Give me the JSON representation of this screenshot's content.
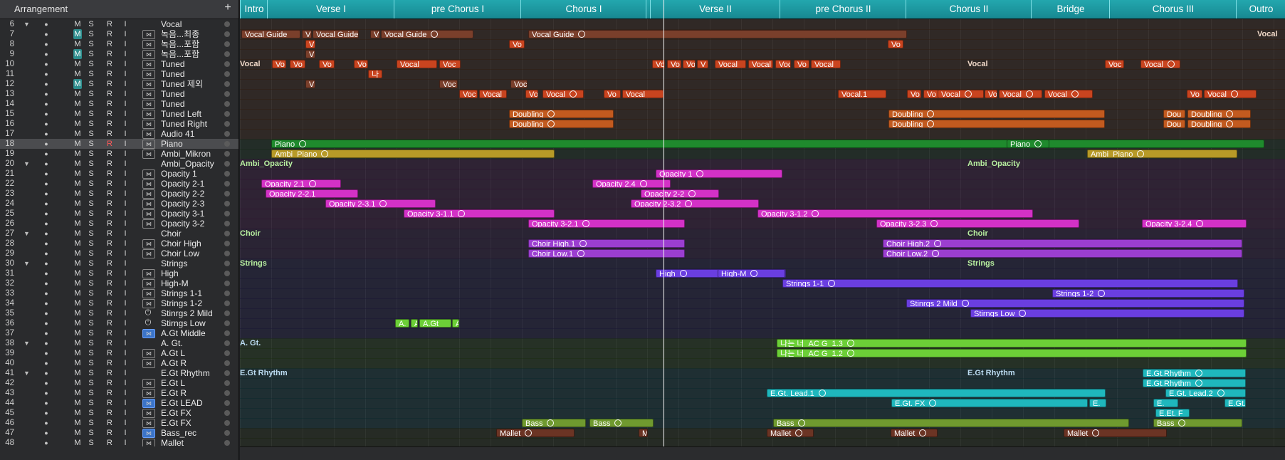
{
  "header": {
    "title": "Arrangement",
    "add_label": "+"
  },
  "colors": {
    "vocal": "#c9441f",
    "vocal_dark": "#7a3f2b",
    "piano": "#1f8a2d",
    "ambi": "#b79a27",
    "opacity": "#d331c6",
    "choir": "#9b3ed0",
    "strings": "#6a3ee0",
    "agt": "#6ccf37",
    "egt": "#1fb7bd",
    "bass": "#6f9a2f",
    "mallet": "#6b3424",
    "doubling": "#c25a1f"
  },
  "markers": [
    {
      "label": "Intro"
    },
    {
      "label": "Verse I"
    },
    {
      "label": "pre Chorus I"
    },
    {
      "label": "Chorus I"
    },
    {
      "label": "Verse II"
    },
    {
      "label": "pre Chorus II"
    },
    {
      "label": "Chorus II"
    },
    {
      "label": "Bridge"
    },
    {
      "label": "Chorus III"
    },
    {
      "label": "Outro"
    }
  ],
  "tracks": [
    {
      "num": "6",
      "name": "Vocal",
      "folder": true
    },
    {
      "num": "7",
      "name": "녹음...최종",
      "m_on": true
    },
    {
      "num": "8",
      "name": "녹음...포함"
    },
    {
      "num": "9",
      "name": "녹음...포함",
      "m_on": true
    },
    {
      "num": "10",
      "name": "Tuned"
    },
    {
      "num": "11",
      "name": "Tuned"
    },
    {
      "num": "12",
      "name": "Tuned 제외",
      "m_on": true
    },
    {
      "num": "13",
      "name": "Tuned"
    },
    {
      "num": "14",
      "name": "Tuned"
    },
    {
      "num": "15",
      "name": "Tuned Left"
    },
    {
      "num": "16",
      "name": "Tuned Right"
    },
    {
      "num": "17",
      "name": "Audio 41"
    },
    {
      "num": "18",
      "name": "Piano",
      "rec": true,
      "selected": true
    },
    {
      "num": "19",
      "name": "Ambi_Mikron"
    },
    {
      "num": "20",
      "name": "Ambi_Opacity",
      "folder": true
    },
    {
      "num": "21",
      "name": "Opacity 1"
    },
    {
      "num": "22",
      "name": "Opacity 2-1"
    },
    {
      "num": "23",
      "name": "Opacity 2-2"
    },
    {
      "num": "24",
      "name": "Opacity 2-3"
    },
    {
      "num": "25",
      "name": "Opacity 3-1"
    },
    {
      "num": "26",
      "name": "Opacity 3-2"
    },
    {
      "num": "27",
      "name": "Choir",
      "folder": true
    },
    {
      "num": "28",
      "name": "Choir High"
    },
    {
      "num": "29",
      "name": "Choir Low"
    },
    {
      "num": "30",
      "name": "Strings",
      "folder": true
    },
    {
      "num": "31",
      "name": "High"
    },
    {
      "num": "32",
      "name": "High-M"
    },
    {
      "num": "33",
      "name": "Strings 1-1"
    },
    {
      "num": "34",
      "name": "Strings 1-2"
    },
    {
      "num": "35",
      "name": "Stinrgs 2 Mild",
      "power": true
    },
    {
      "num": "36",
      "name": "Stirngs Low",
      "power": true
    },
    {
      "num": "37",
      "name": "A.Gt Middle",
      "blue": true
    },
    {
      "num": "38",
      "name": "A. Gt.",
      "folder": true
    },
    {
      "num": "39",
      "name": "A.Gt L"
    },
    {
      "num": "40",
      "name": "A.Gt R"
    },
    {
      "num": "41",
      "name": "E.Gt Rhythm",
      "folder": true
    },
    {
      "num": "42",
      "name": "E.Gt L"
    },
    {
      "num": "43",
      "name": "E.Gt R"
    },
    {
      "num": "44",
      "name": "E.Gt LEAD",
      "blue": true
    },
    {
      "num": "45",
      "name": "E.Gt FX"
    },
    {
      "num": "46",
      "name": "E.Gt FX"
    },
    {
      "num": "47",
      "name": "Bass_rec",
      "blue": true
    },
    {
      "num": "48",
      "name": "Mallet"
    }
  ],
  "button_labels": {
    "mute": "M",
    "solo": "S",
    "record": "R",
    "input": "I"
  },
  "folder_labels": [
    {
      "text": "Vocal",
      "color": "#f0d9c9"
    },
    {
      "text": "Vocal",
      "color": "#f0d9c9"
    },
    {
      "text": "Ambi_Opacity",
      "color": "#b8f0a0"
    },
    {
      "text": "Ambi_Opacity",
      "color": "#b8f0a0"
    },
    {
      "text": "Choir",
      "color": "#b8f0a0"
    },
    {
      "text": "Choir",
      "color": "#b8f0a0"
    },
    {
      "text": "Strings",
      "color": "#b8f0a0"
    },
    {
      "text": "Strings",
      "color": "#b8f0a0"
    },
    {
      "text": "A. Gt.",
      "color": "#bcdcf2"
    },
    {
      "text": "A. Gt.",
      "color": "#bcdcf2"
    },
    {
      "text": "E.Gt Rhythm",
      "color": "#bcdcf2"
    },
    {
      "text": "E.Gt Rhythm",
      "color": "#bcdcf2"
    },
    {
      "text": "Vocal",
      "color": "#f0d9c9"
    }
  ],
  "regions": [
    {
      "label": "Vocal Guide"
    },
    {
      "label": "V"
    },
    {
      "label": "Vocal Guide"
    },
    {
      "label": "V"
    },
    {
      "label": "Vocal Guide"
    },
    {
      "label": "Vocal Guide"
    },
    {
      "label": "V"
    },
    {
      "label": "Vo"
    },
    {
      "label": "Vo"
    },
    {
      "label": "V"
    },
    {
      "label": "Vo"
    },
    {
      "label": "Vo"
    },
    {
      "label": "Vo"
    },
    {
      "label": "Vo"
    },
    {
      "label": "Vocal"
    },
    {
      "label": "Voc"
    },
    {
      "label": "Vo"
    },
    {
      "label": "Vo"
    },
    {
      "label": "Vo"
    },
    {
      "label": "V"
    },
    {
      "label": "Vocal"
    },
    {
      "label": "Vocal"
    },
    {
      "label": "Voc"
    },
    {
      "label": "Vo"
    },
    {
      "label": "Vocal"
    },
    {
      "label": "Voc"
    },
    {
      "label": "Vocal"
    },
    {
      "label": "나"
    },
    {
      "label": "V"
    },
    {
      "label": "Voc"
    },
    {
      "label": "Voc"
    },
    {
      "label": "Voc"
    },
    {
      "label": "Vocal"
    },
    {
      "label": "Vo"
    },
    {
      "label": "Vocal"
    },
    {
      "label": "Vo"
    },
    {
      "label": "Vocal"
    },
    {
      "label": "Vocal.1"
    },
    {
      "label": "Vo"
    },
    {
      "label": "Vo"
    },
    {
      "label": "Vocal"
    },
    {
      "label": "Vo"
    },
    {
      "label": "Vocal"
    },
    {
      "label": "Vocal"
    },
    {
      "label": "Vo"
    },
    {
      "label": "Vocal"
    },
    {
      "label": "Doubling"
    },
    {
      "label": "Doubling"
    },
    {
      "label": "Dou"
    },
    {
      "label": "Doubling"
    },
    {
      "label": "Doubling"
    },
    {
      "label": "Doubling"
    },
    {
      "label": "Dou"
    },
    {
      "label": "Doubling"
    },
    {
      "label": "Piano"
    },
    {
      "label": "Piano"
    },
    {
      "label": "Ambi_Piano"
    },
    {
      "label": "Ambi_Piano"
    },
    {
      "label": "Opacity 1"
    },
    {
      "label": "Opacity 2.1"
    },
    {
      "label": "Opacity 2.4"
    },
    {
      "label": "Opacity 2-2.1"
    },
    {
      "label": "Opacity 2-2"
    },
    {
      "label": "Opacity 2-3.1"
    },
    {
      "label": "Opacity 2-3.2"
    },
    {
      "label": "Opacity 3-1.1"
    },
    {
      "label": "Opacity 3-1.2"
    },
    {
      "label": "Opacity 3-2.1"
    },
    {
      "label": "Opacity 3-2.3"
    },
    {
      "label": "Opacity 3-2.4"
    },
    {
      "label": "Choir High.1"
    },
    {
      "label": "Choir High.2"
    },
    {
      "label": "Choir Low.1"
    },
    {
      "label": "Choir Low.2"
    },
    {
      "label": "High"
    },
    {
      "label": "High-M"
    },
    {
      "label": "Strings 1-1"
    },
    {
      "label": "Strings 1-2"
    },
    {
      "label": "Stinrgs 2 Mild"
    },
    {
      "label": "Stirngs Low"
    },
    {
      "label": "A."
    },
    {
      "label": "A.Gt"
    },
    {
      "label": "A.Gt"
    },
    {
      "label": "A.Gt"
    },
    {
      "label": "나는 너_AC G_1.3"
    },
    {
      "label": "나는 너_AC G_1.2"
    },
    {
      "label": "E.Gt.Rhythm"
    },
    {
      "label": "E.Gt.Rhythm"
    },
    {
      "label": "E.Gt. Lead.1"
    },
    {
      "label": "E.Gt. Lead.2"
    },
    {
      "label": "E.Gt. FX"
    },
    {
      "label": "E."
    },
    {
      "label": "E."
    },
    {
      "label": "E.Gt."
    },
    {
      "label": "E.Et. F"
    },
    {
      "label": "Bass"
    },
    {
      "label": "Bass"
    },
    {
      "label": "Bass"
    },
    {
      "label": "Bass"
    },
    {
      "label": "Mallet"
    },
    {
      "label": "Malle"
    },
    {
      "label": "Mallet"
    },
    {
      "label": "Mallet"
    },
    {
      "label": "Mallet"
    }
  ]
}
